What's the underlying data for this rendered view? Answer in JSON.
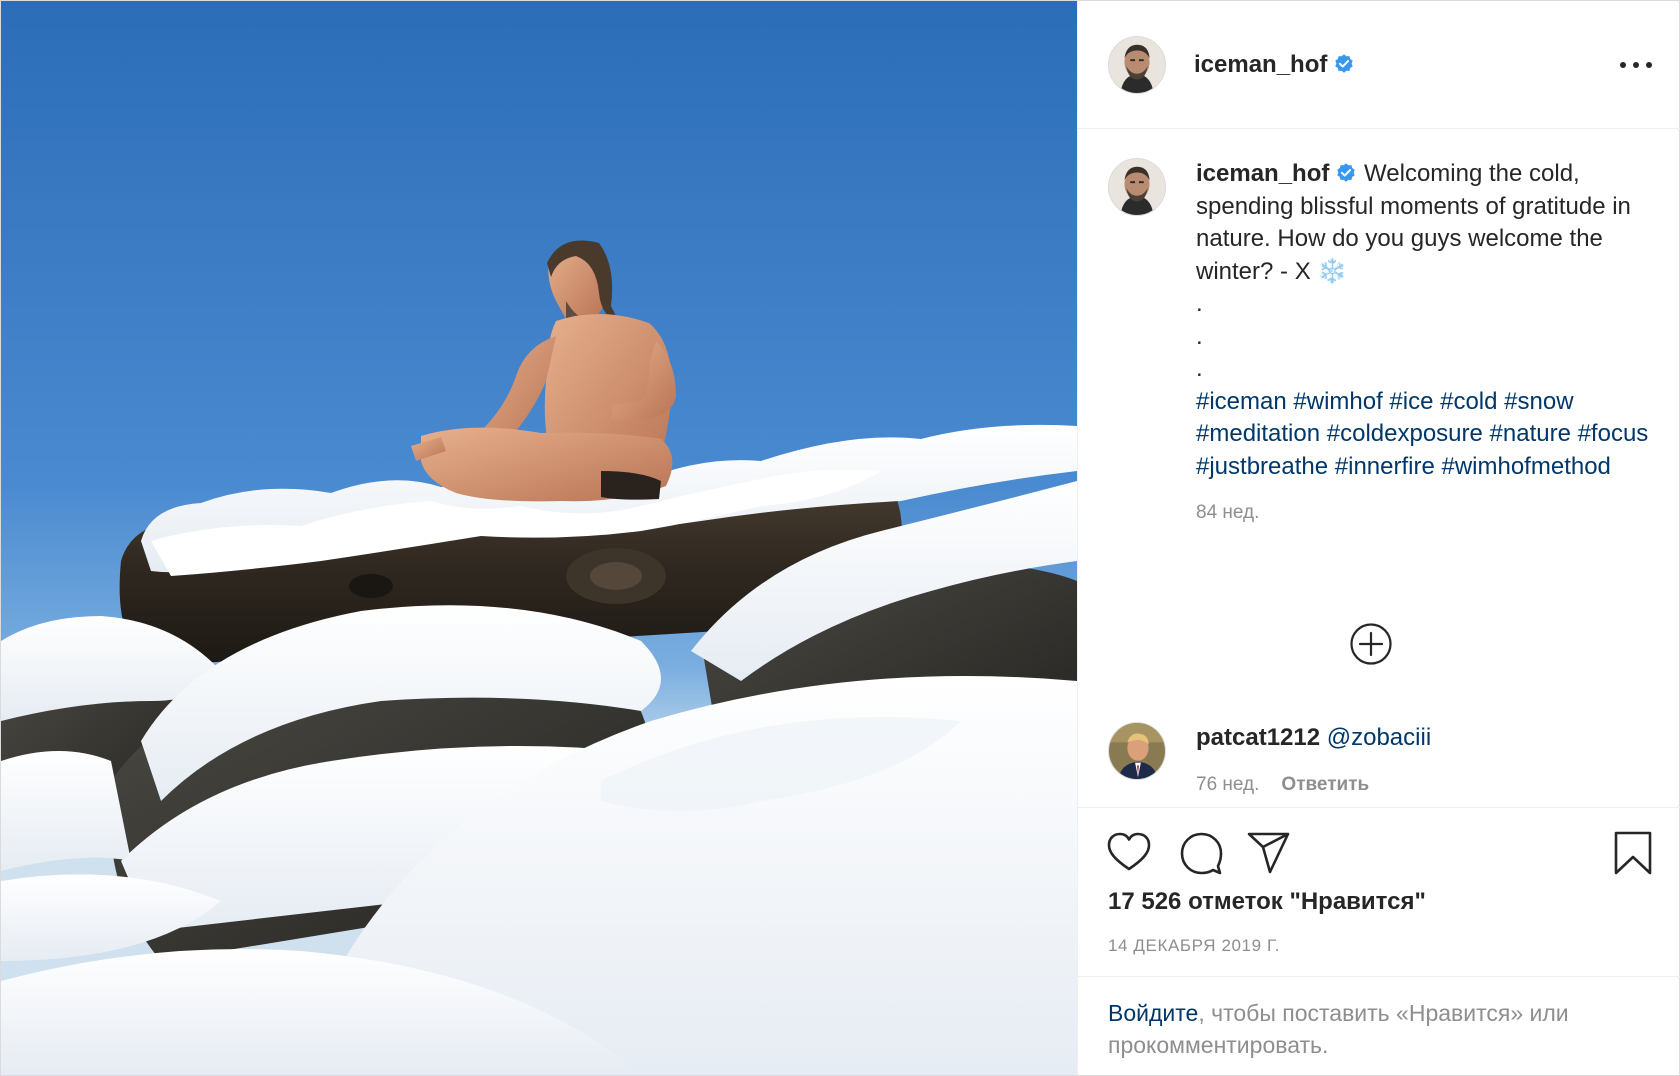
{
  "post": {
    "author": {
      "username": "iceman_hof",
      "verified": true
    },
    "caption": {
      "username": "iceman_hof",
      "text": "Welcoming the cold, spending blissful moments of gratitude in nature. How do you guys welcome the winter? - X ❄️\n.\n.\n.",
      "hashtags": "#iceman #wimhof #ice #cold #snow #meditation #coldexposure #nature #focus #justbreathe #innerfire #wimhofmethod",
      "age": "84 нед."
    },
    "comments": [
      {
        "username": "patcat1212",
        "mention": "@zobaciii",
        "age": "76 нед.",
        "reply_label": "Ответить"
      }
    ],
    "likes_text": "17 526 отметок \"Нравится\"",
    "date_text": "14 ДЕКАБРЯ 2019 Г.",
    "login_prompt": {
      "link_text": "Войдите",
      "rest_text": ", чтобы поставить «Нравится» или прокомментировать."
    }
  },
  "icons": {
    "more": "more-options-icon",
    "load_more": "plus-circle-icon",
    "like": "heart-icon",
    "comment": "comment-icon",
    "share": "paper-plane-icon",
    "save": "bookmark-icon",
    "verified": "verified-badge-icon"
  },
  "colors": {
    "link": "#00376b",
    "verified": "#3897f0",
    "muted": "#8e8e8e",
    "text": "#262626"
  }
}
